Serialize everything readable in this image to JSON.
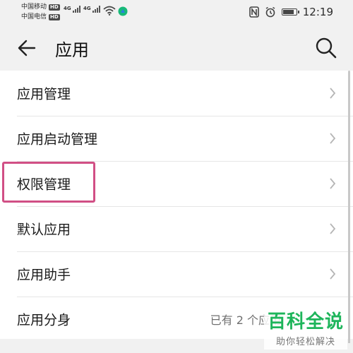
{
  "status_bar": {
    "carrier_1": "中国移动",
    "carrier_2": "中国电信",
    "hd_label": "HD",
    "network_1": "4G",
    "network_2": "4G",
    "time": "12:19",
    "battery_level": 0.75,
    "icons": [
      "signal-icon",
      "wifi-icon",
      "nfc-icon",
      "alarm-icon",
      "battery-icon"
    ]
  },
  "app_bar": {
    "title": "应用",
    "back_icon": "arrow-left-icon",
    "search_icon": "search-icon"
  },
  "list": {
    "items": [
      {
        "label": "应用管理",
        "value": ""
      },
      {
        "label": "应用启动管理",
        "value": ""
      },
      {
        "label": "权限管理",
        "value": "",
        "highlighted": true
      },
      {
        "label": "默认应用",
        "value": ""
      },
      {
        "label": "应用助手",
        "value": ""
      },
      {
        "label": "应用分身",
        "value": "已有 2 个应用"
      }
    ]
  },
  "watermark": {
    "main": "百科全说",
    "sub": "助你轻松解决"
  },
  "colors": {
    "background": "#f1f1f1",
    "list_background": "#ffffff",
    "highlight": "#d14f85",
    "watermark": "#1eb55b"
  }
}
